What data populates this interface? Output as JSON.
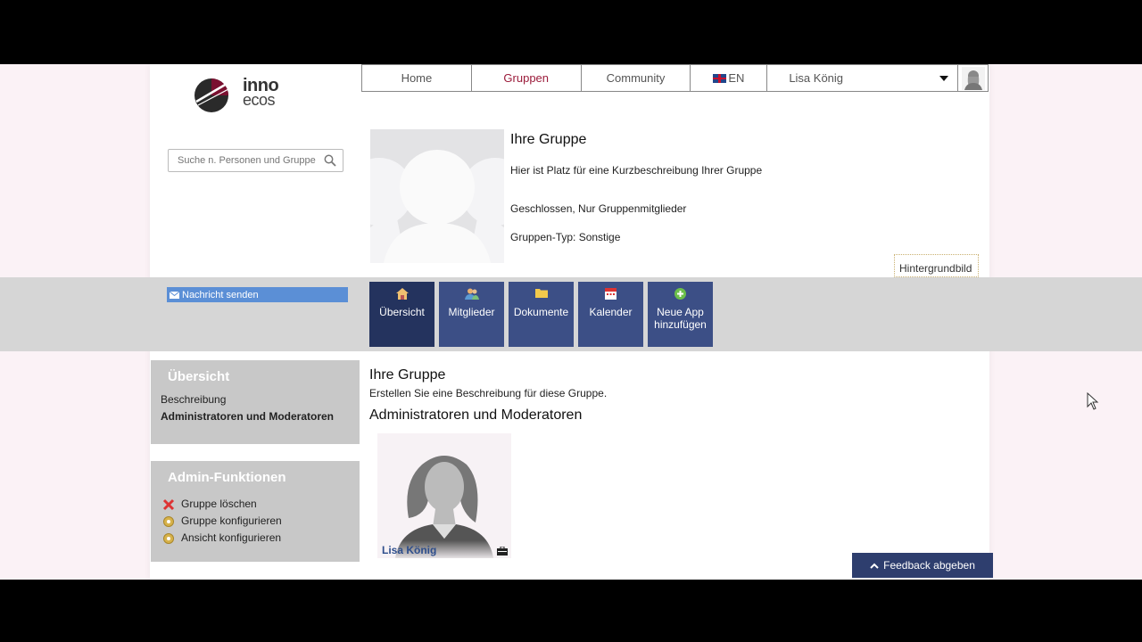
{
  "nav": {
    "home": "Home",
    "groups": "Gruppen",
    "community": "Community",
    "lang": "EN",
    "user": "Lisa König"
  },
  "logo": {
    "line1": "inno",
    "line2": "ecos"
  },
  "search": {
    "placeholder": "Suche n. Personen und Gruppen"
  },
  "group": {
    "title": "Ihre Gruppe",
    "description": "Hier ist Platz für eine Kurzbeschreibung Ihrer Gruppe",
    "access": "Geschlossen, Nur Gruppenmitglieder",
    "type": "Gruppen-Typ: Sonstige",
    "background_button": "Hintergrundbild"
  },
  "message_button": "Nachricht senden",
  "apps": [
    {
      "label": "Übersicht",
      "icon": "home-icon"
    },
    {
      "label": "Mitglieder",
      "icon": "members-icon"
    },
    {
      "label": "Dokumente",
      "icon": "folder-icon"
    },
    {
      "label": "Kalender",
      "icon": "calendar-icon"
    },
    {
      "label": "Neue App hinzufügen",
      "icon": "plus-icon"
    }
  ],
  "sidebar": {
    "overview": {
      "title": "Übersicht",
      "links": [
        "Beschreibung",
        "Administratoren und Moderatoren"
      ]
    },
    "admin": {
      "title": "Admin-Funktionen",
      "items": [
        "Gruppe löschen",
        "Gruppe konfigurieren",
        "Ansicht konfigurieren"
      ]
    }
  },
  "main": {
    "title": "Ihre Gruppe",
    "subtitle": "Erstellen Sie eine Beschreibung für diese Gruppe.",
    "admins_heading": "Administratoren und Moderatoren",
    "member_name": "Lisa König"
  },
  "feedback": "Feedback abgeben",
  "colors": {
    "accent": "#9b1b3a",
    "tile": "#3c4f86",
    "tile_active": "#24335e",
    "message_button": "#5b8fd6",
    "feedback": "#2e3e6e"
  }
}
